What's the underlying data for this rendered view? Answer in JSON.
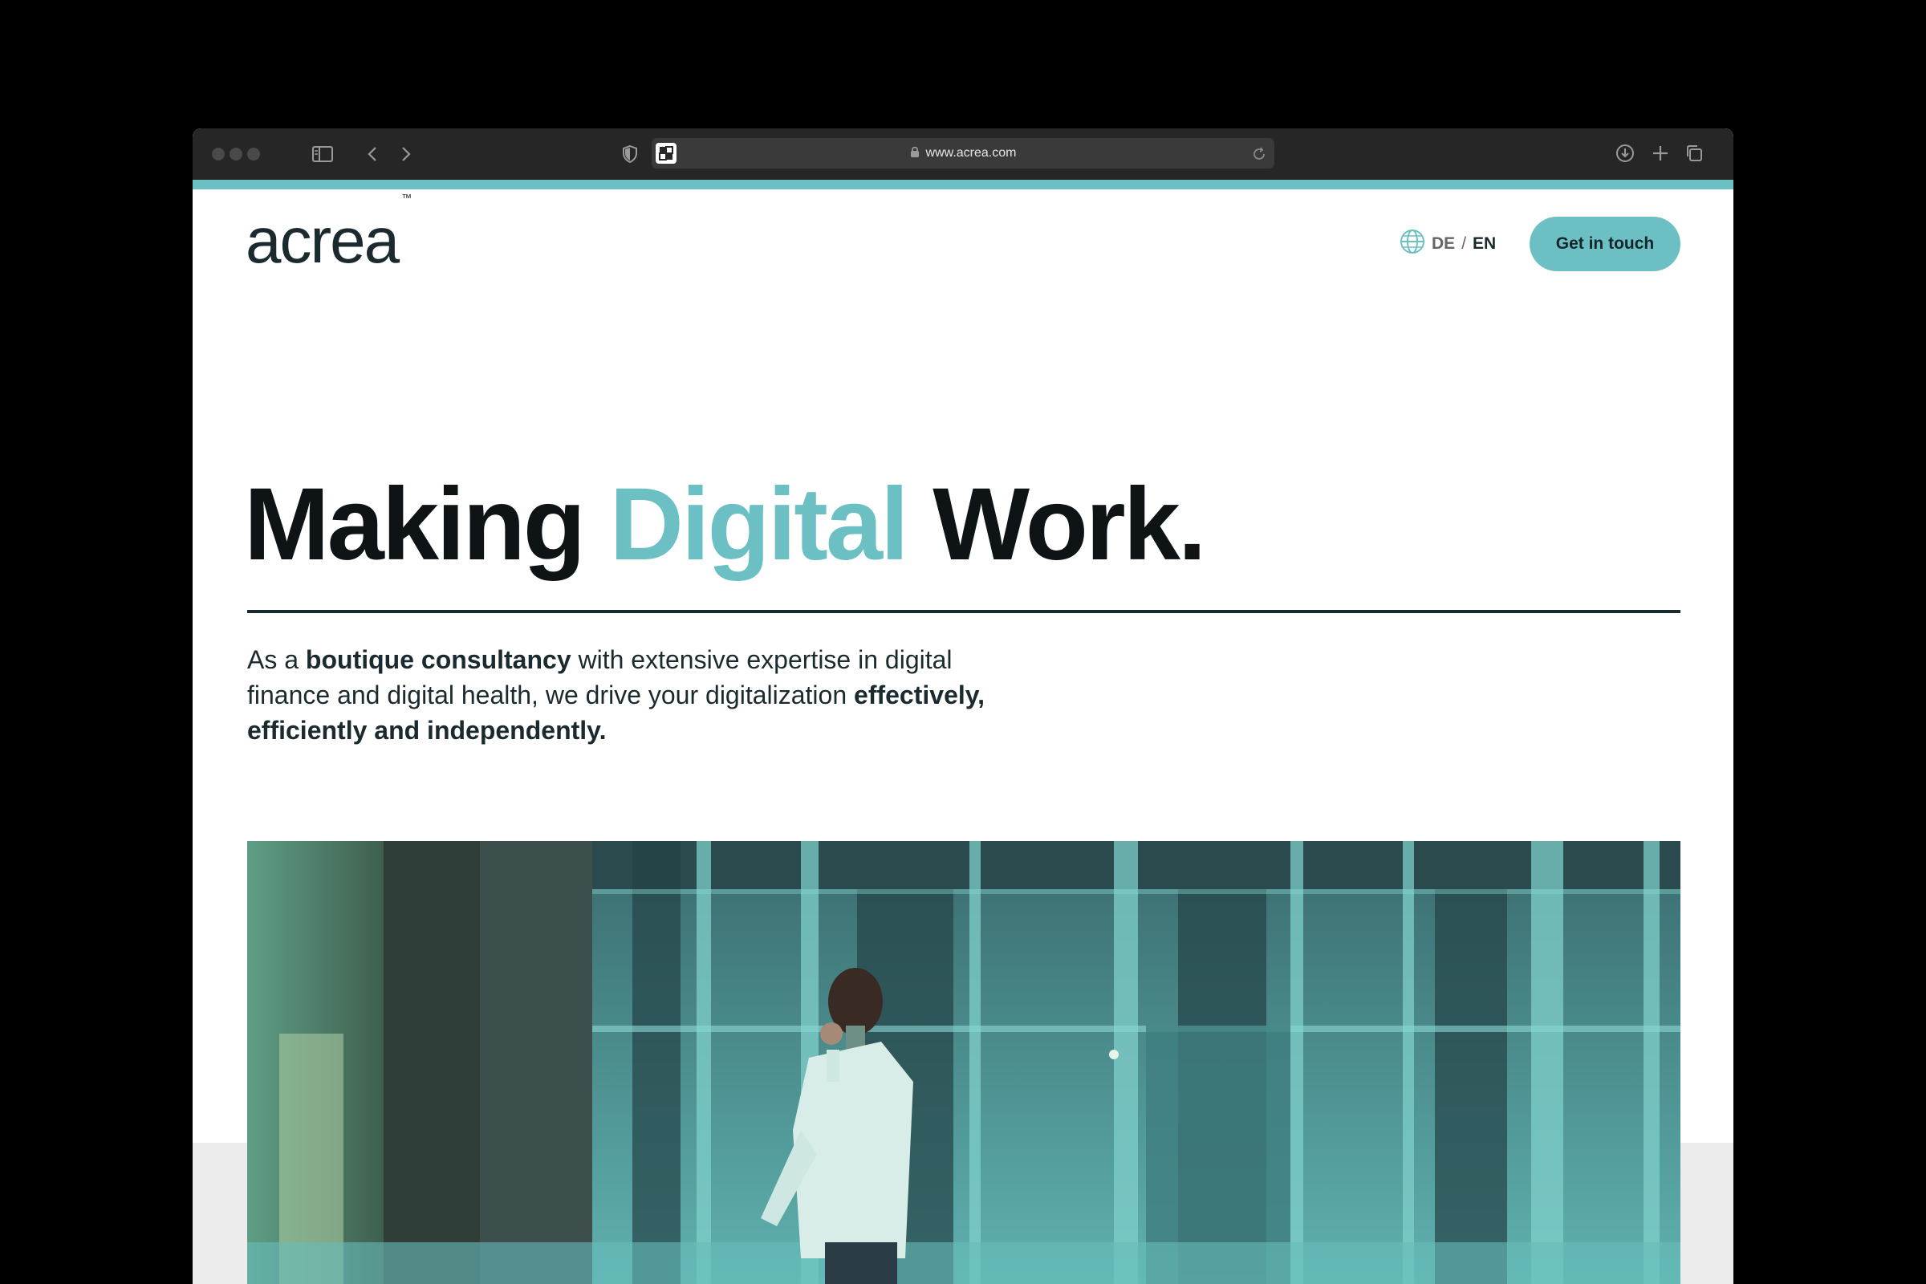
{
  "browser": {
    "url": "www.acrea.com",
    "icons": [
      "sidebar-icon",
      "back-icon",
      "forward-icon",
      "shield-icon",
      "favicon",
      "lock-icon",
      "reload-icon",
      "download-icon",
      "new-tab-icon",
      "tabs-overview-icon"
    ]
  },
  "colors": {
    "accent": "#6cc0c3",
    "dark": "#1b2a2f",
    "chrome": "#262626"
  },
  "header": {
    "logo_text": "acrea",
    "logo_tm": "™",
    "lang_de": "DE",
    "lang_sep": "/",
    "lang_en": "EN",
    "cta_label": "Get in touch"
  },
  "hero": {
    "headline_part1": "Making ",
    "headline_accent": "Digital",
    "headline_part2": " Work.",
    "intro": {
      "t1": "As a ",
      "b1": "boutique consultancy",
      "t2": " with extensive expertise in digital finance and digital health, we drive your digitalization ",
      "b2": "effectively, efficiently and independently."
    }
  }
}
